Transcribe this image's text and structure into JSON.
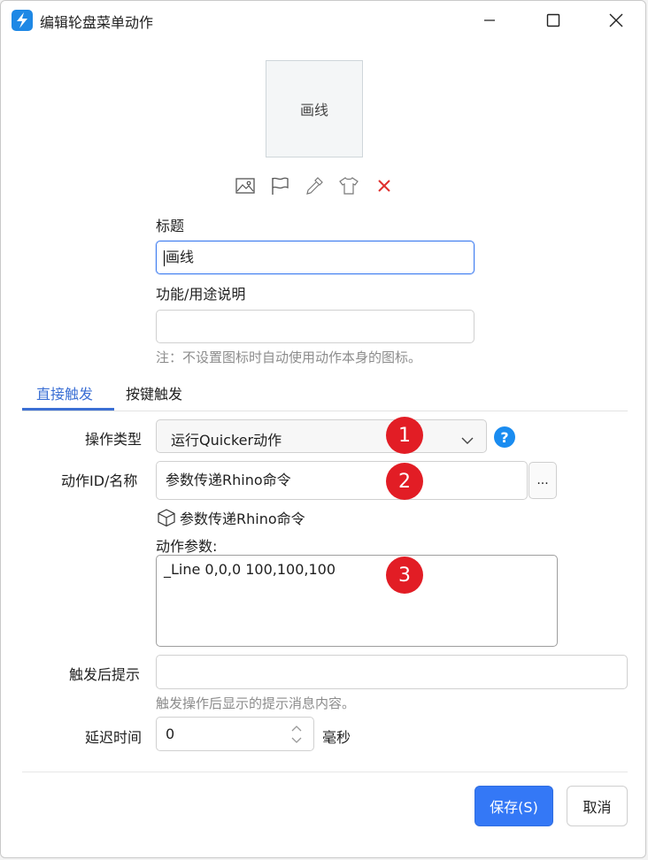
{
  "window": {
    "title": "编辑轮盘菜单动作"
  },
  "preview": {
    "text": "画线"
  },
  "toolbar": {
    "icons": [
      "image-icon",
      "flag-icon",
      "eyedropper-icon",
      "tshirt-icon",
      "close-icon"
    ],
    "colors": {
      "delete": "#e0302e",
      "icon": "#555555"
    }
  },
  "form": {
    "title_label": "标题",
    "title_value": "画线",
    "desc_label": "功能/用途说明",
    "desc_value": "",
    "note": "注：不设置图标时自动使用动作本身的图标。"
  },
  "tabs": [
    {
      "label": "直接触发",
      "active": true
    },
    {
      "label": "按键触发",
      "active": false
    }
  ],
  "trigger": {
    "op_type_label": "操作类型",
    "op_type_value": "运行Quicker动作",
    "action_id_label": "动作ID/名称",
    "action_id_value": "参数传递Rhino命令",
    "browse_label": "...",
    "action_link": "参数传递Rhino命令",
    "params_label": "动作参数:",
    "params_value": "_Line 0,0,0 100,100,100",
    "after_tip_label": "触发后提示",
    "after_tip_value": "",
    "after_tip_hint": "触发操作后显示的提示消息内容。",
    "delay_label": "延迟时间",
    "delay_value": "0",
    "delay_unit": "毫秒"
  },
  "badges": [
    "1",
    "2",
    "3"
  ],
  "buttons": {
    "save": "保存(S)",
    "cancel": "取消"
  },
  "colors": {
    "accent": "#3478f6",
    "badge": "#e21d25",
    "help": "#1a8cf0",
    "tab_active": "#3b6fd4"
  }
}
